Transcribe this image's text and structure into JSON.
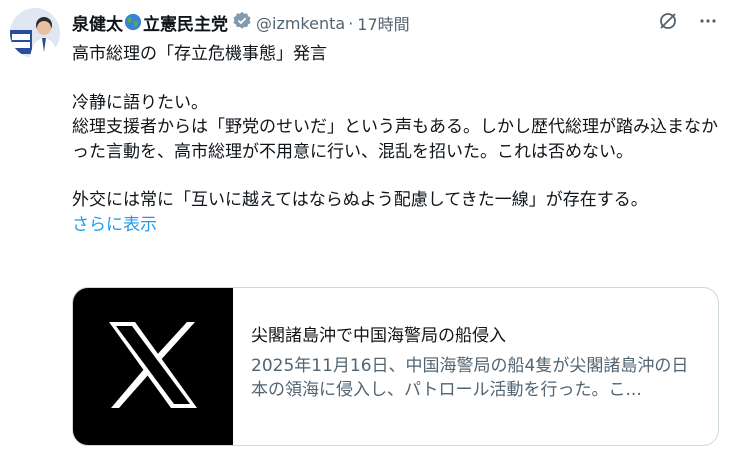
{
  "tweet": {
    "display_name_prefix": "泉健太",
    "display_name_suffix": "立憲民主党",
    "handle": "@izmkenta",
    "separator": "·",
    "time": "17時間",
    "lines": [
      "高市総理の「存立危機事態」発言",
      "冷静に語りたい。",
      "総理支援者からは「野党のせいだ」という声もある。しかし歴代総理が踏み込まなかった言動を、高市総理が不用意に行い、混乱を招いた。これは否めない。",
      "外交には常に「互いに越えてはならぬよう配慮してきた一線」が存在する。"
    ],
    "show_more": "さらに表示",
    "colors": {
      "accent": "#1d9bf0",
      "muted": "#536471",
      "text": "#0f1419",
      "verified": "#829aab"
    }
  },
  "card": {
    "title": "尖閣諸島沖で中国海警局の船侵入",
    "description": "2025年11月16日、中国海警局の船4隻が尖閣諸島沖の日本の領海に侵入し、パトロール活動を行った。こ..."
  },
  "icons": {
    "globe": "globe-icon",
    "verified": "verified-badge-icon",
    "grok": "grok-icon",
    "more": "more-icon",
    "x_logo": "x-logo-icon"
  }
}
